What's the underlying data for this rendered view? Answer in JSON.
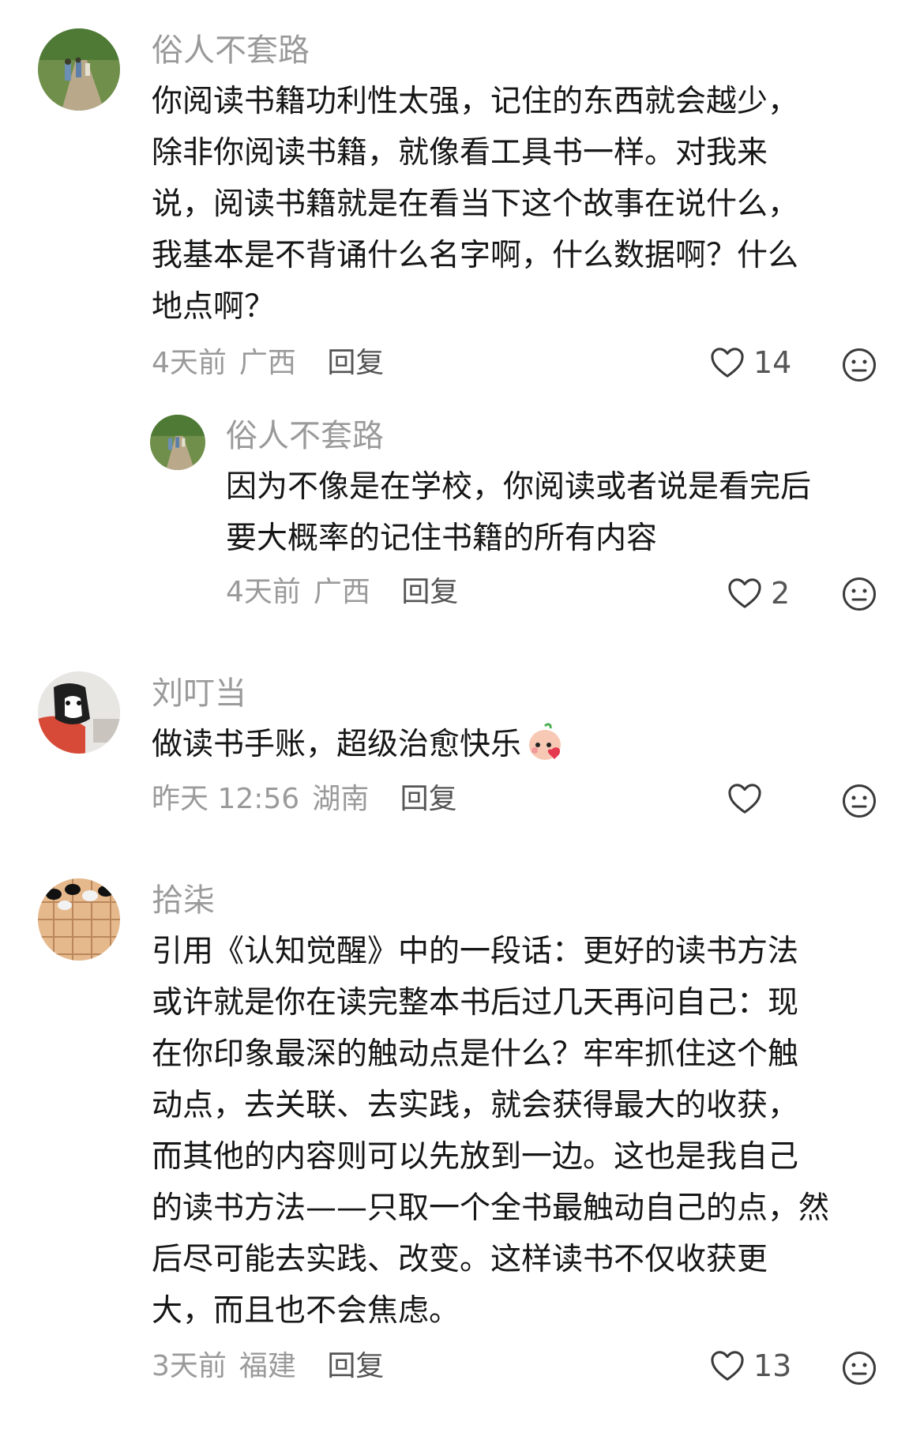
{
  "comments": [
    {
      "user": "俗人不套路",
      "lines": [
        "你阅读书籍功利性太强，记住的东西就会越少，",
        "除非你阅读书籍，就像看工具书一样。对我来",
        "说，阅读书籍就是在看当下这个故事在说什么，",
        "我基本是不背诵什么名字啊，什么数据啊？什么",
        "地点啊？"
      ],
      "time": "4天前",
      "location": "广西",
      "reply": "回复",
      "likes": "14"
    },
    {
      "user": "俗人不套路",
      "lines": [
        "因为不像是在学校，你阅读或者说是看完后",
        "要大概率的记住书籍的所有内容"
      ],
      "time": "4天前",
      "location": "广西",
      "reply": "回复",
      "likes": "2"
    },
    {
      "user": "刘叮当",
      "lines": [
        "做读书手账，超级治愈快乐"
      ],
      "time": "昨天 12:56",
      "location": "湖南",
      "reply": "回复",
      "likes": ""
    },
    {
      "user": "拾柒",
      "lines": [
        "引用《认知觉醒》中的一段话：更好的读书方法",
        "或许就是你在读完整本书后过几天再问自己：现",
        "在你印象最深的触动点是什么？牢牢抓住这个触",
        "动点，去关联、去实践，就会获得最大的收获，",
        "而其他的内容则可以先放到一边。这也是我自己",
        "的读书方法——只取一个全书最触动自己的点，然",
        "后尽可能去实践、改变。这样读书不仅收获更",
        "大，而且也不会焦虑。"
      ],
      "time": "3天前",
      "location": "福建",
      "reply": "回复",
      "likes": "13"
    }
  ],
  "icons": {
    "like": "heart-outline-icon",
    "more": "neutral-face-icon",
    "emoji": "baby-face-emoji"
  },
  "colors": {
    "text": "#161616",
    "meta": "#9a9a9a",
    "reply": "#555555",
    "icon": "#3a3a3a"
  }
}
